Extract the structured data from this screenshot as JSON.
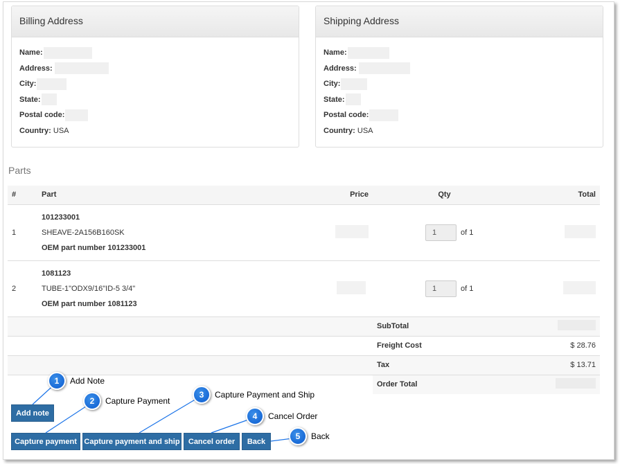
{
  "billing": {
    "title": "Billing Address",
    "name_label": "Name:",
    "address_label": "Address:",
    "city_label": "City:",
    "state_label": "State:",
    "postal_label": "Postal code:",
    "country_label": "Country:",
    "country_value": "USA"
  },
  "shipping": {
    "title": "Shipping Address",
    "name_label": "Name:",
    "address_label": "Address:",
    "city_label": "City:",
    "state_label": "State:",
    "postal_label": "Postal code:",
    "country_label": "Country:",
    "country_value": "USA"
  },
  "parts": {
    "title": "Parts",
    "headers": {
      "num": "#",
      "part": "Part",
      "price": "Price",
      "qty": "Qty",
      "total": "Total"
    },
    "items": [
      {
        "num": "1",
        "id": "101233001",
        "desc": "SHEAVE-2A156B160SK",
        "oem": "OEM part number 101233001",
        "qty": "1",
        "of": "of 1"
      },
      {
        "num": "2",
        "id": "1081123",
        "desc": "TUBE-1\"ODX9/16\"ID-5 3/4\"",
        "oem": "OEM part number 1081123",
        "qty": "1",
        "of": "of 1"
      }
    ],
    "summary": {
      "subtotal_label": "SubTotal",
      "freight_label": "Freight Cost",
      "freight_value": "$ 28.76",
      "tax_label": "Tax",
      "tax_value": "$ 13.71",
      "order_total_label": "Order Total"
    }
  },
  "buttons": {
    "add_note": "Add note",
    "capture_payment": "Capture payment",
    "capture_and_ship": "Capture payment and ship",
    "cancel_order": "Cancel order",
    "back": "Back"
  },
  "callouts": [
    {
      "num": "1",
      "text": "Add Note"
    },
    {
      "num": "2",
      "text": "Capture Payment"
    },
    {
      "num": "3",
      "text": "Capture Payment and Ship"
    },
    {
      "num": "4",
      "text": "Cancel Order"
    },
    {
      "num": "5",
      "text": "Back"
    }
  ],
  "colors": {
    "button": "#2e6da4",
    "callout": "#0b5bd0"
  }
}
